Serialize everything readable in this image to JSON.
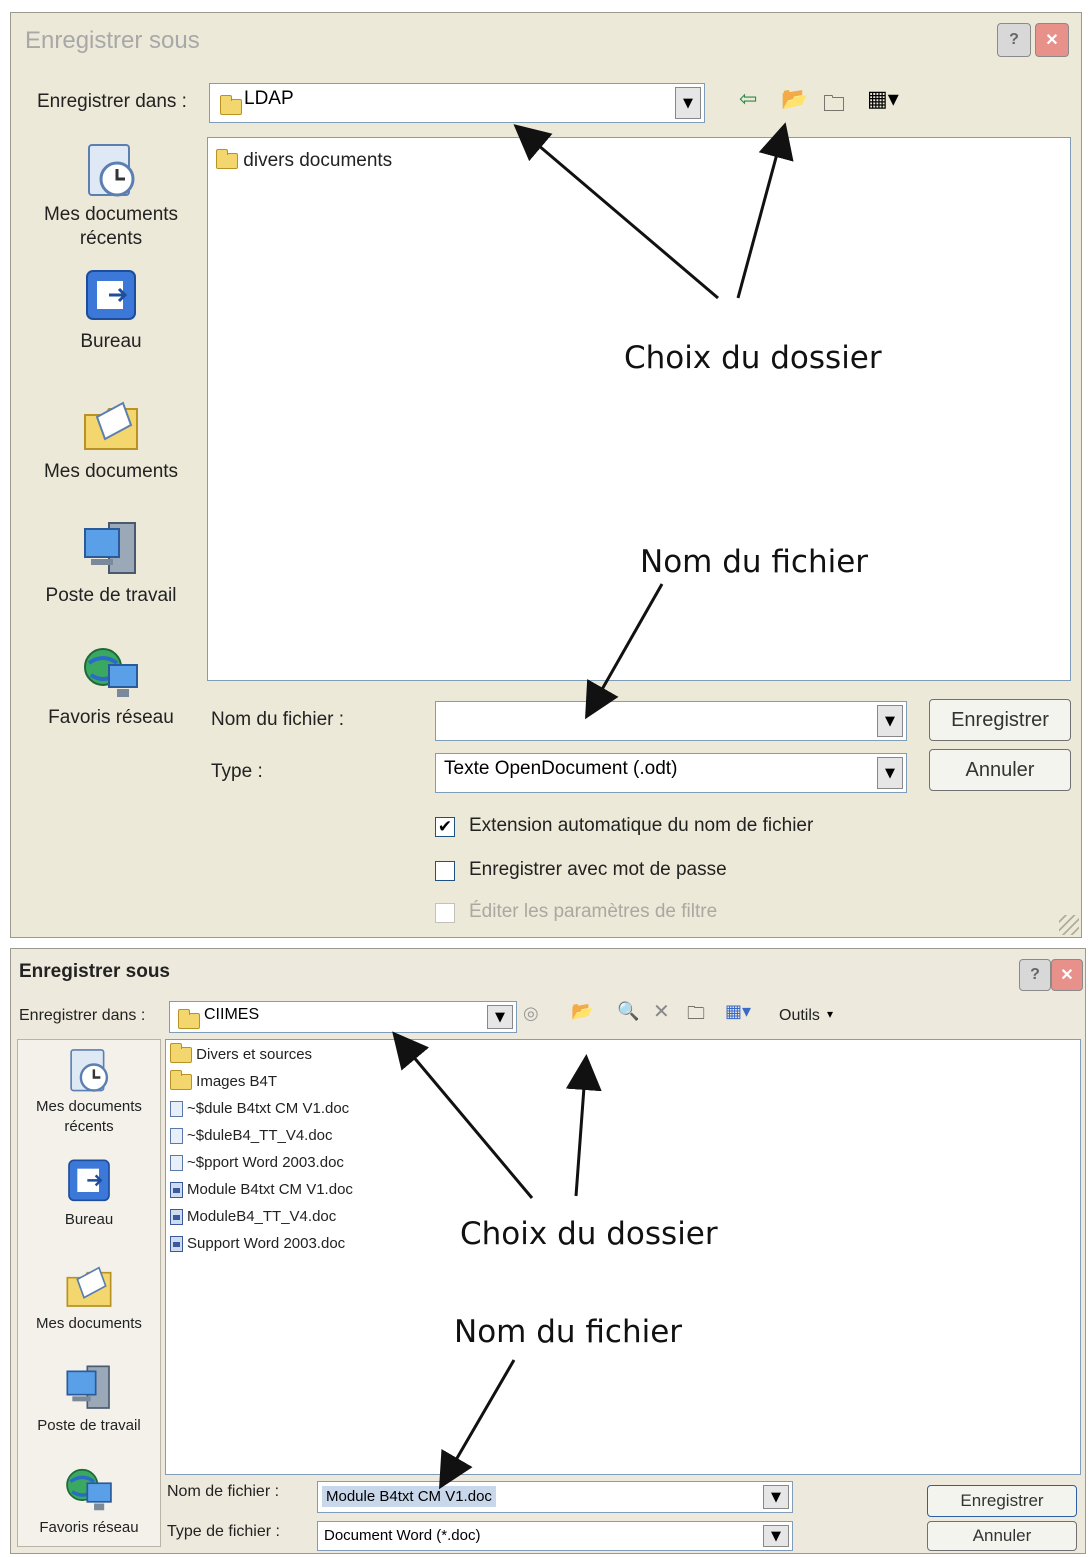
{
  "dialog1": {
    "title": "Enregistrer sous",
    "save_in_label": "Enregistrer dans :",
    "save_in_value": "LDAP",
    "places": [
      {
        "label": "Mes documents récents",
        "icon": "recent-documents-icon"
      },
      {
        "label": "Bureau",
        "icon": "desktop-icon"
      },
      {
        "label": "Mes documents",
        "icon": "my-documents-icon"
      },
      {
        "label": "Poste de travail",
        "icon": "my-computer-icon"
      },
      {
        "label": "Favoris réseau",
        "icon": "network-places-icon"
      }
    ],
    "files": [
      {
        "name": "divers documents",
        "type": "folder"
      }
    ],
    "filename_label": "Nom du fichier :",
    "filename_value": "",
    "type_label": "Type :",
    "type_value": "Texte OpenDocument (.odt)",
    "save_button": "Enregistrer",
    "cancel_button": "Annuler",
    "options": [
      {
        "label": "Extension automatique du nom de fichier",
        "checked": true,
        "enabled": true
      },
      {
        "label": "Enregistrer avec mot de passe",
        "checked": false,
        "enabled": true
      },
      {
        "label": "Éditer les paramètres de filtre",
        "checked": false,
        "enabled": false
      }
    ],
    "annotation_folder": "Choix du dossier",
    "annotation_filename": "Nom du fichier"
  },
  "dialog2": {
    "title": "Enregistrer sous",
    "save_in_label": "Enregistrer dans :",
    "save_in_value": "CIIMES",
    "tools_label": "Outils",
    "places": [
      {
        "label": "Mes documents récents",
        "icon": "recent-documents-icon"
      },
      {
        "label": "Bureau",
        "icon": "desktop-icon"
      },
      {
        "label": "Mes documents",
        "icon": "my-documents-icon"
      },
      {
        "label": "Poste de travail",
        "icon": "my-computer-icon"
      },
      {
        "label": "Favoris réseau",
        "icon": "network-places-icon"
      }
    ],
    "files": [
      {
        "name": "Divers et sources",
        "type": "folder"
      },
      {
        "name": "Images B4T",
        "type": "folder"
      },
      {
        "name": "~$dule B4txt CM V1.doc",
        "type": "temp-doc"
      },
      {
        "name": "~$duleB4_TT_V4.doc",
        "type": "temp-doc"
      },
      {
        "name": "~$pport Word 2003.doc",
        "type": "temp-doc"
      },
      {
        "name": "Module B4txt CM V1.doc",
        "type": "doc"
      },
      {
        "name": "ModuleB4_TT_V4.doc",
        "type": "doc"
      },
      {
        "name": "Support Word 2003.doc",
        "type": "doc"
      }
    ],
    "filename_label": "Nom de fichier :",
    "filename_value": "Module B4txt CM V1.doc",
    "type_label": "Type de fichier :",
    "type_value": "Document Word (*.doc)",
    "save_button": "Enregistrer",
    "cancel_button": "Annuler",
    "annotation_folder": "Choix du dossier",
    "annotation_filename": "Nom du fichier"
  },
  "colors": {
    "dialog_bg": "#ece9d8",
    "close_red": "#e7918a",
    "selection": "#c9d7ea",
    "folder": "#f3d66d"
  }
}
